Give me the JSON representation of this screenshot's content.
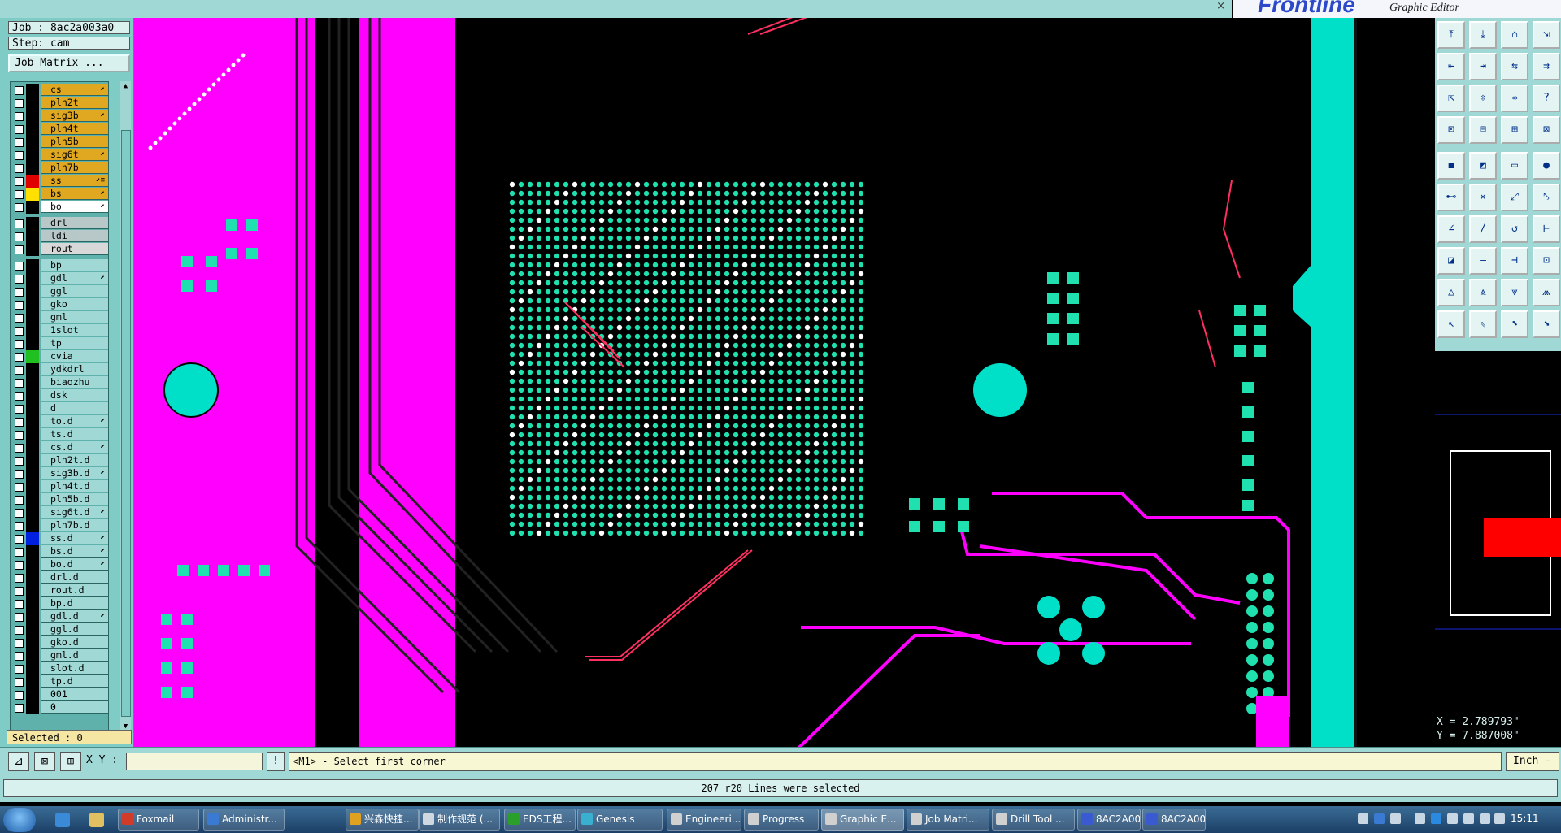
{
  "window": {
    "close_glyph": "×"
  },
  "logo": {
    "brand": "Frontline",
    "subtitle": "Graphic Editor"
  },
  "job": {
    "label": "Job : 8ac2a003a0",
    "step": "Step: cam",
    "matrix_button": "Job Matrix ..."
  },
  "layers": [
    {
      "name": "cs",
      "color": "#e0a820",
      "swatch": "#000000",
      "mark": "⬋"
    },
    {
      "name": "pln2t",
      "color": "#e0a820",
      "swatch": "#000000",
      "mark": ""
    },
    {
      "name": "sig3b",
      "color": "#e0a820",
      "swatch": "#000000",
      "mark": "⬋"
    },
    {
      "name": "pln4t",
      "color": "#e0a820",
      "swatch": "#000000",
      "mark": ""
    },
    {
      "name": "pln5b",
      "color": "#e0a820",
      "swatch": "#000000",
      "mark": ""
    },
    {
      "name": "sig6t",
      "color": "#e0a820",
      "swatch": "#000000",
      "mark": "⬋"
    },
    {
      "name": "pln7b",
      "color": "#e0a820",
      "swatch": "#000000",
      "mark": ""
    },
    {
      "name": "ss",
      "color": "#e0a820",
      "swatch": "#e00000",
      "mark": "⬋≡"
    },
    {
      "name": "bs",
      "color": "#e0a820",
      "swatch": "#ffe000",
      "mark": "⬋"
    },
    {
      "name": "bo",
      "color": "#ffffff",
      "swatch": "#000000",
      "mark": "⬋"
    },
    {
      "name": "drl",
      "color": "#b8c8c8",
      "swatch": "#000000",
      "mark": ""
    },
    {
      "name": "ldi",
      "color": "#b8c8c8",
      "swatch": "#000000",
      "mark": ""
    },
    {
      "name": "rout",
      "color": "#d8d8d8",
      "swatch": "#000000",
      "mark": ""
    },
    {
      "name": "bp",
      "color": "#9fd8d4",
      "swatch": "#000000",
      "mark": ""
    },
    {
      "name": "gdl",
      "color": "#9fd8d4",
      "swatch": "#000000",
      "mark": "⬋"
    },
    {
      "name": "ggl",
      "color": "#9fd8d4",
      "swatch": "#000000",
      "mark": ""
    },
    {
      "name": "gko",
      "color": "#9fd8d4",
      "swatch": "#000000",
      "mark": ""
    },
    {
      "name": "gml",
      "color": "#9fd8d4",
      "swatch": "#000000",
      "mark": ""
    },
    {
      "name": "1slot",
      "color": "#9fd8d4",
      "swatch": "#000000",
      "mark": ""
    },
    {
      "name": "tp",
      "color": "#9fd8d4",
      "swatch": "#000000",
      "mark": ""
    },
    {
      "name": "cvia",
      "color": "#9fd8d4",
      "swatch": "#20c020",
      "mark": ""
    },
    {
      "name": "ydkdrl",
      "color": "#9fd8d4",
      "swatch": "#000000",
      "mark": ""
    },
    {
      "name": "biaozhu",
      "color": "#9fd8d4",
      "swatch": "#000000",
      "mark": ""
    },
    {
      "name": "dsk",
      "color": "#9fd8d4",
      "swatch": "#000000",
      "mark": ""
    },
    {
      "name": "d",
      "color": "#9fd8d4",
      "swatch": "#000000",
      "mark": ""
    },
    {
      "name": "to.d",
      "color": "#9fd8d4",
      "swatch": "#000000",
      "mark": "⬋"
    },
    {
      "name": "ts.d",
      "color": "#9fd8d4",
      "swatch": "#000000",
      "mark": ""
    },
    {
      "name": "cs.d",
      "color": "#9fd8d4",
      "swatch": "#000000",
      "mark": "⬋"
    },
    {
      "name": "pln2t.d",
      "color": "#9fd8d4",
      "swatch": "#000000",
      "mark": ""
    },
    {
      "name": "sig3b.d",
      "color": "#9fd8d4",
      "swatch": "#000000",
      "mark": "⬋"
    },
    {
      "name": "pln4t.d",
      "color": "#9fd8d4",
      "swatch": "#000000",
      "mark": ""
    },
    {
      "name": "pln5b.d",
      "color": "#9fd8d4",
      "swatch": "#000000",
      "mark": ""
    },
    {
      "name": "sig6t.d",
      "color": "#9fd8d4",
      "swatch": "#000000",
      "mark": "⬋"
    },
    {
      "name": "pln7b.d",
      "color": "#9fd8d4",
      "swatch": "#000000",
      "mark": ""
    },
    {
      "name": "ss.d",
      "color": "#9fd8d4",
      "swatch": "#0020e0",
      "mark": "⬋"
    },
    {
      "name": "bs.d",
      "color": "#9fd8d4",
      "swatch": "#000000",
      "mark": "⬋"
    },
    {
      "name": "bo.d",
      "color": "#9fd8d4",
      "swatch": "#000000",
      "mark": "⬋"
    },
    {
      "name": "drl.d",
      "color": "#9fd8d4",
      "swatch": "#000000",
      "mark": ""
    },
    {
      "name": "rout.d",
      "color": "#9fd8d4",
      "swatch": "#000000",
      "mark": ""
    },
    {
      "name": "bp.d",
      "color": "#9fd8d4",
      "swatch": "#000000",
      "mark": ""
    },
    {
      "name": "gdl.d",
      "color": "#9fd8d4",
      "swatch": "#000000",
      "mark": "⬋"
    },
    {
      "name": "ggl.d",
      "color": "#9fd8d4",
      "swatch": "#000000",
      "mark": ""
    },
    {
      "name": "gko.d",
      "color": "#9fd8d4",
      "swatch": "#000000",
      "mark": ""
    },
    {
      "name": "gml.d",
      "color": "#9fd8d4",
      "swatch": "#000000",
      "mark": ""
    },
    {
      "name": "slot.d",
      "color": "#9fd8d4",
      "swatch": "#000000",
      "mark": ""
    },
    {
      "name": "tp.d",
      "color": "#9fd8d4",
      "swatch": "#000000",
      "mark": ""
    },
    {
      "name": "001",
      "color": "#9fd8d4",
      "swatch": "#000000",
      "mark": ""
    },
    {
      "name": "0",
      "color": "#9fd8d4",
      "swatch": "#000000",
      "mark": ""
    }
  ],
  "selected_label": "Selected : 0",
  "coords": {
    "x": "X = 2.789793\"",
    "y": "Y = 7.887008\""
  },
  "command": {
    "xy_label": "X Y :",
    "xy_value": "",
    "bang": "!",
    "prompt": "<M1> - Select first corner",
    "units": "Inch -"
  },
  "status_message": "207 r20 Lines were selected",
  "taskbar": {
    "tasks": [
      {
        "label": "Foxmail",
        "icon": "#d23a2a"
      },
      {
        "label": "Administr...",
        "icon": "#3a7ad2"
      },
      {
        "label": "兴森快捷...",
        "icon": "#e0a020"
      },
      {
        "label": "制作规范 (...",
        "icon": "#cfd8e0"
      },
      {
        "label": "EDS工程...",
        "icon": "#2aa02a"
      },
      {
        "label": "Genesis",
        "icon": "#3ab0d0"
      },
      {
        "label": "Engineeri...",
        "icon": "#d0d0d0"
      },
      {
        "label": "Progress",
        "icon": "#d0d0d0"
      },
      {
        "label": "Graphic E...",
        "icon": "#d0d0d0"
      },
      {
        "label": "Job Matri...",
        "icon": "#d0d0d0"
      },
      {
        "label": "Drill Tool ...",
        "icon": "#d0d0d0"
      },
      {
        "label": "8AC2A00...",
        "icon": "#3a5ad2"
      },
      {
        "label": "8AC2A00...",
        "icon": "#3a5ad2"
      }
    ],
    "clock": "15:11"
  },
  "colors": {
    "cyan": "#00e0c8",
    "magenta": "#ff00ff",
    "pad_green": "#20e0b0",
    "red_trace": "#ff3060",
    "teal_ui": "#9fd8d4"
  }
}
